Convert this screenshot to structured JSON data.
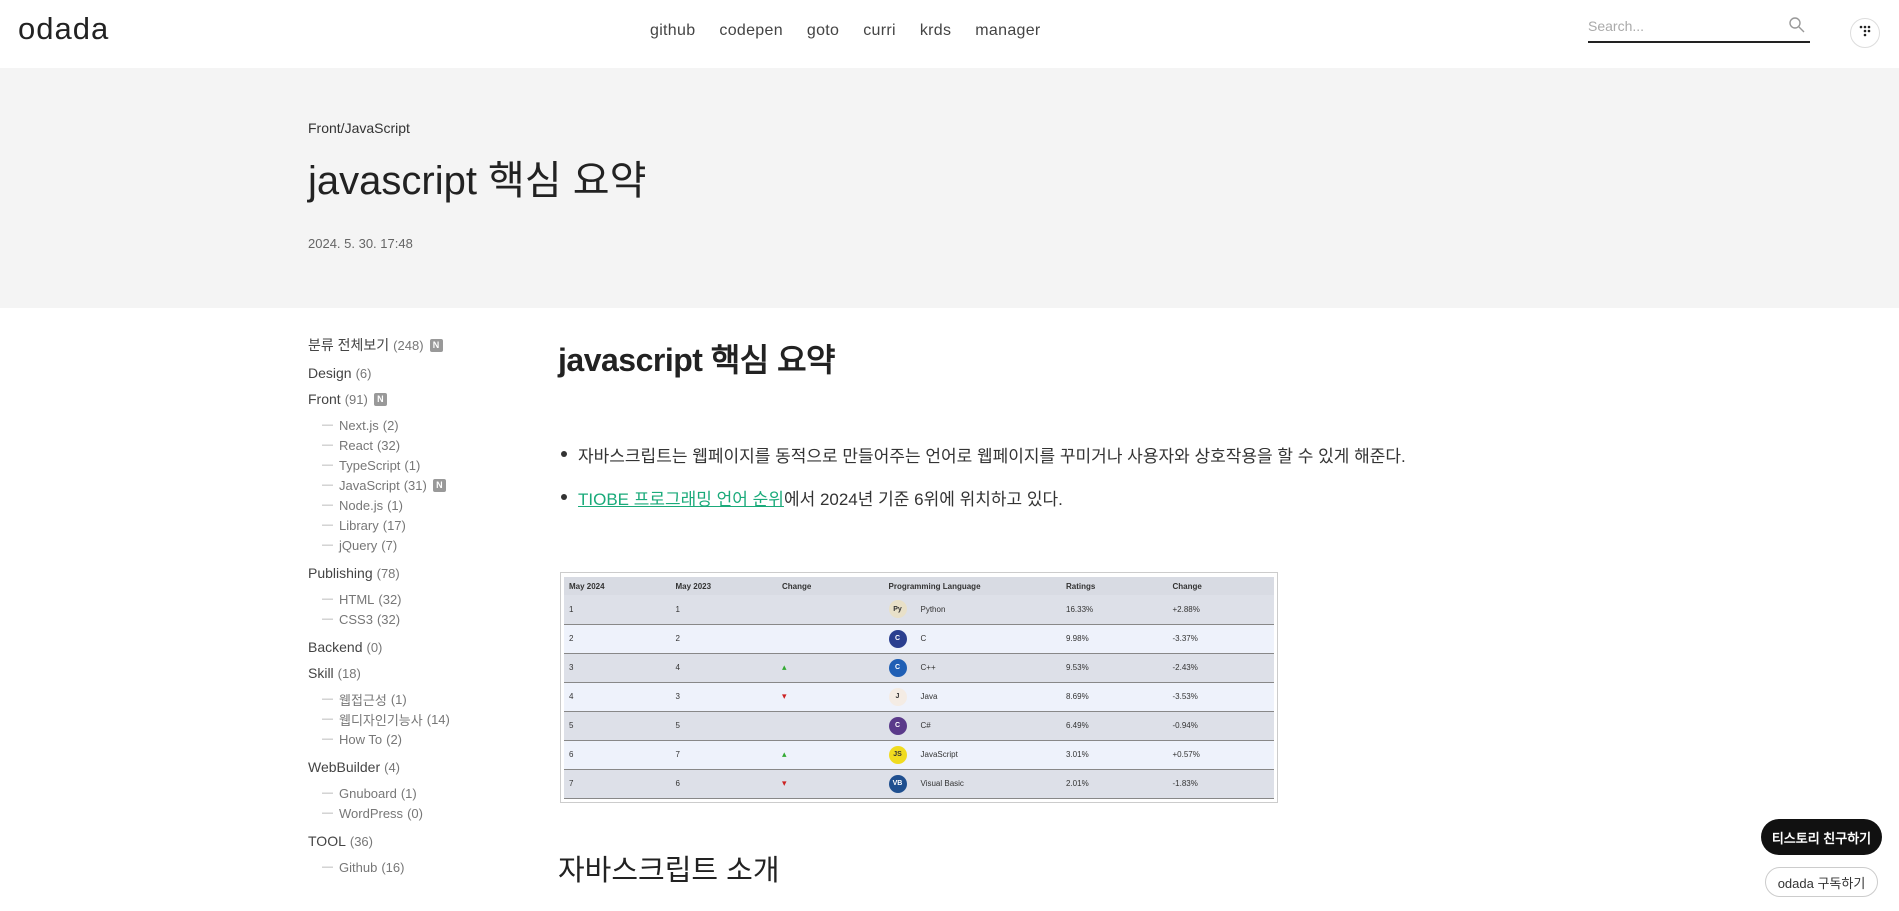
{
  "header": {
    "logo": "odada",
    "nav": [
      "github",
      "codepen",
      "goto",
      "curri",
      "krds",
      "manager"
    ],
    "search_placeholder": "Search..."
  },
  "hero": {
    "category": "Front/JavaScript",
    "title": "javascript 핵심 요약",
    "date": "2024. 5. 30. 17:48"
  },
  "sidebar": {
    "groups": [
      {
        "label": "분류 전체보기",
        "count": "(248)",
        "new": true,
        "subs": []
      },
      {
        "label": "Design",
        "count": "(6)",
        "new": false,
        "subs": []
      },
      {
        "label": "Front",
        "count": "(91)",
        "new": true,
        "subs": [
          {
            "label": "Next.js",
            "count": "(2)",
            "new": false
          },
          {
            "label": "React",
            "count": "(32)",
            "new": false
          },
          {
            "label": "TypeScript",
            "count": "(1)",
            "new": false
          },
          {
            "label": "JavaScript",
            "count": "(31)",
            "new": true
          },
          {
            "label": "Node.js",
            "count": "(1)",
            "new": false
          },
          {
            "label": "Library",
            "count": "(17)",
            "new": false
          },
          {
            "label": "jQuery",
            "count": "(7)",
            "new": false
          }
        ]
      },
      {
        "label": "Publishing",
        "count": "(78)",
        "new": false,
        "subs": [
          {
            "label": "HTML",
            "count": "(32)",
            "new": false
          },
          {
            "label": "CSS3",
            "count": "(32)",
            "new": false
          }
        ]
      },
      {
        "label": "Backend",
        "count": "(0)",
        "new": false,
        "subs": []
      },
      {
        "label": "Skill",
        "count": "(18)",
        "new": false,
        "subs": [
          {
            "label": "웹접근성",
            "count": "(1)",
            "new": false
          },
          {
            "label": "웹디자인기능사",
            "count": "(14)",
            "new": false
          },
          {
            "label": "How To",
            "count": "(2)",
            "new": false
          }
        ]
      },
      {
        "label": "WebBuilder",
        "count": "(4)",
        "new": false,
        "subs": [
          {
            "label": "Gnuboard",
            "count": "(1)",
            "new": false
          },
          {
            "label": "WordPress",
            "count": "(0)",
            "new": false
          }
        ]
      },
      {
        "label": "TOOL",
        "count": "(36)",
        "new": false,
        "subs": [
          {
            "label": "Github",
            "count": "(16)",
            "new": false
          }
        ]
      }
    ],
    "new_badge": "N"
  },
  "article": {
    "heading": "javascript 핵심 요약",
    "bullet1": "자바스크립트는 웹페이지를 동적으로 만들어주는 언어로 웹페이지를 꾸미거나 사용자와 상호작용을 할 수 있게 해준다.",
    "bullet2_link": "TIOBE 프로그래밍 언어 순위",
    "bullet2_rest": "에서 2024년 기준 6위에 위치하고 있다.",
    "section_heading": "자바스크립트 소개"
  },
  "tiobe_table": {
    "headers": [
      "May 2024",
      "May 2023",
      "Change",
      "Programming Language",
      "Ratings",
      "Change"
    ],
    "rows": [
      {
        "may2024": "1",
        "may2023": "1",
        "trend": "",
        "language": "Python",
        "icon": "python-icon",
        "icon_color": "#e8e0c8",
        "icon_text": "Py",
        "ratings": "16.33%",
        "change": "+2.88%"
      },
      {
        "may2024": "2",
        "may2023": "2",
        "trend": "",
        "language": "C",
        "icon": "c-icon",
        "icon_color": "#2a3f8f",
        "icon_text": "C",
        "ratings": "9.98%",
        "change": "-3.37%"
      },
      {
        "may2024": "3",
        "may2023": "4",
        "trend": "up",
        "language": "C++",
        "icon": "cpp-icon",
        "icon_color": "#1f5fb5",
        "icon_text": "C",
        "ratings": "9.53%",
        "change": "-2.43%"
      },
      {
        "may2024": "4",
        "may2023": "3",
        "trend": "down",
        "language": "Java",
        "icon": "java-icon",
        "icon_color": "#f4ece4",
        "icon_text": "J",
        "ratings": "8.69%",
        "change": "-3.53%"
      },
      {
        "may2024": "5",
        "may2023": "5",
        "trend": "",
        "language": "C#",
        "icon": "csharp-icon",
        "icon_color": "#5a3a8a",
        "icon_text": "C",
        "ratings": "6.49%",
        "change": "-0.94%"
      },
      {
        "may2024": "6",
        "may2023": "7",
        "trend": "up",
        "language": "JavaScript",
        "icon": "javascript-icon",
        "icon_color": "#f0db1f",
        "icon_text": "JS",
        "ratings": "3.01%",
        "change": "+0.57%"
      },
      {
        "may2024": "7",
        "may2023": "6",
        "trend": "down",
        "language": "Visual Basic",
        "icon": "visual-basic-icon",
        "icon_color": "#1f4f8f",
        "icon_text": "VB",
        "ratings": "2.01%",
        "change": "-1.83%"
      }
    ]
  },
  "floating": {
    "friend_label": "티스토리 친구하기",
    "subscribe_label": "odada 구독하기"
  }
}
